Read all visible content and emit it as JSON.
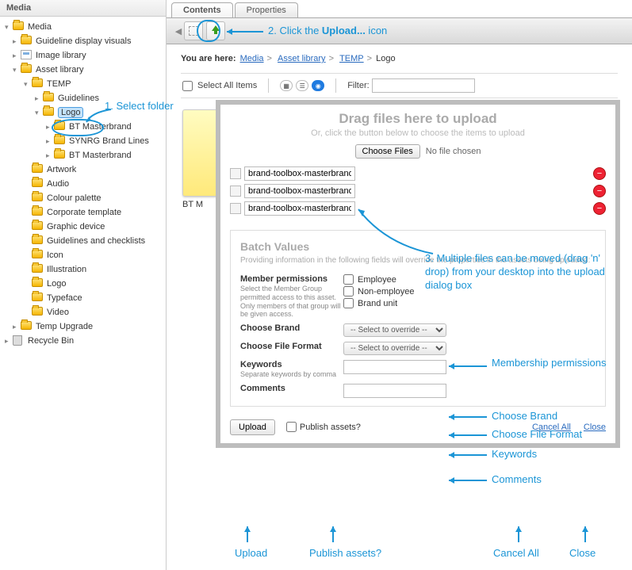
{
  "sidebar": {
    "title": "Media",
    "root": "Media",
    "guideline": "Guideline display visuals",
    "imagelib": "Image library",
    "assetlib": "Asset library",
    "temp": "TEMP",
    "guidelines": "Guidelines",
    "logo": "Logo",
    "btmaster1": "BT Masterbrand",
    "synrg": "SYNRG Brand Lines",
    "btmaster2": "BT Masterbrand",
    "artwork": "Artwork",
    "audio": "Audio",
    "colour": "Colour palette",
    "corporate": "Corporate template",
    "graphic": "Graphic device",
    "gcheck": "Guidelines and checklists",
    "icon": "Icon",
    "illustration": "Illustration",
    "logo2": "Logo",
    "typeface": "Typeface",
    "video": "Video",
    "tempupgrade": "Temp Upgrade",
    "recycle": "Recycle Bin"
  },
  "tabs": {
    "contents": "Contents",
    "properties": "Properties"
  },
  "breadcrumb": {
    "prefix": "You are here:",
    "p1": "Media",
    "p2": "Asset library",
    "p3": "TEMP",
    "p4": "Logo"
  },
  "listbar": {
    "selectall": "Select All Items",
    "filter": "Filter:"
  },
  "thumb": {
    "label": "BT M"
  },
  "dialog": {
    "drop_title": "Drag files here to upload",
    "drop_sub": "Or, click the button below to choose the items to upload",
    "choose": "Choose Files",
    "nofile": "No file chosen",
    "files": [
      "brand-toolbox-masterbrand-lo",
      "brand-toolbox-masterbrand-lo",
      "brand-toolbox-masterbrand-lo"
    ],
    "batch_title": "Batch Values",
    "batch_desc": "Providing information in the following fields will override the properties in the assets being uploaded:",
    "perm_label": "Member permissions",
    "perm_sub": "Select the Member Group permitted access to this asset. Only members of that group will be given access.",
    "perm_employee": "Employee",
    "perm_non": "Non-employee",
    "perm_brand": "Brand unit",
    "choose_brand": "Choose Brand",
    "choose_format": "Choose File Format",
    "select_placeholder": "-- Select to override --",
    "keywords": "Keywords",
    "keywords_note": "Separate keywords by comma",
    "comments": "Comments",
    "upload": "Upload",
    "publish": "Publish assets?",
    "cancel_all": "Cancel All",
    "close": "Close"
  },
  "anno": {
    "step1": "1. Select folder",
    "step2_a": "2. Click the ",
    "step2_b": "Upload...",
    "step2_c": " icon",
    "step3": "3. Multiple files can be moved (drag 'n' drop) from your desktop into the upload dialog box",
    "perm": "Membership permissions",
    "brand": "Choose Brand",
    "format": "Choose File Format",
    "keywords": "Keywords",
    "comments": "Comments",
    "upload": "Upload",
    "publish": "Publish assets?",
    "cancel": "Cancel All",
    "close": "Close"
  }
}
